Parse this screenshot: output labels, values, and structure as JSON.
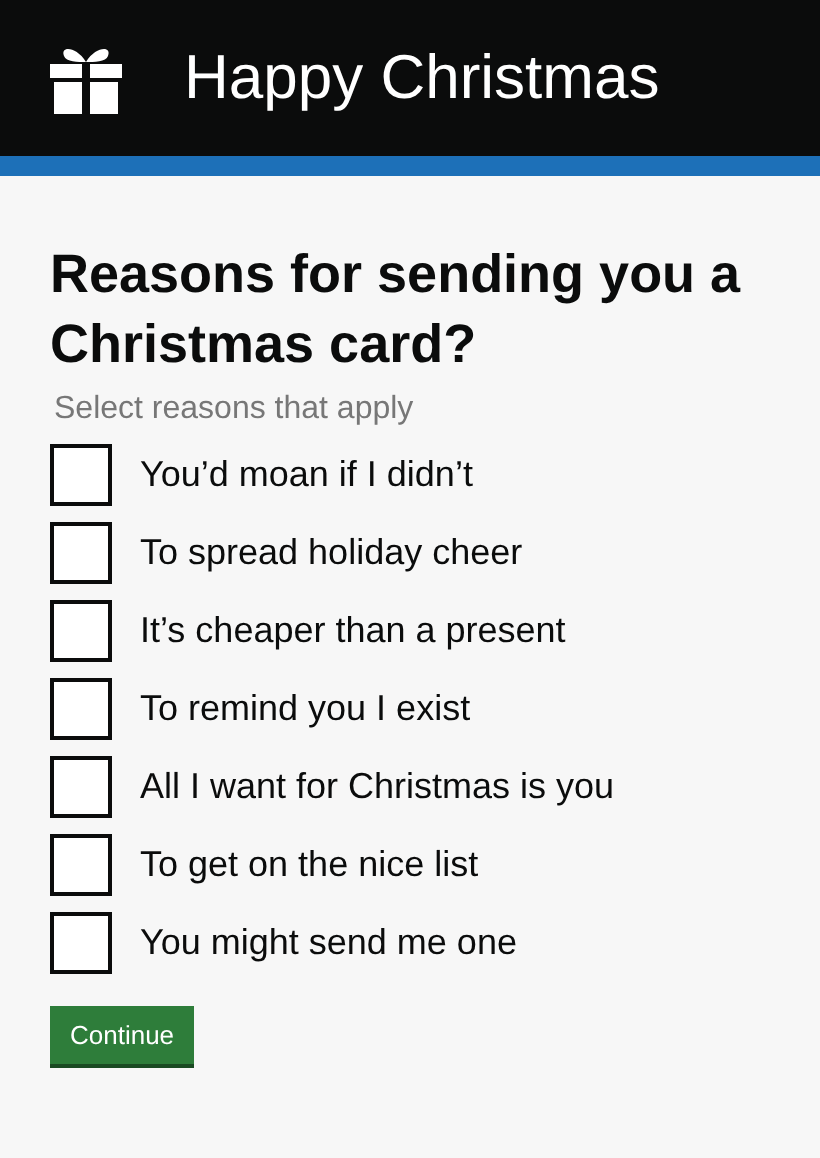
{
  "header": {
    "title": "Happy Christmas"
  },
  "question": {
    "heading": "Reasons for sending you a Christmas card?",
    "hint": "Select reasons that apply"
  },
  "options": [
    {
      "label": "You’d moan if I didn’t",
      "checked": false
    },
    {
      "label": "To spread holiday cheer",
      "checked": false
    },
    {
      "label": "It’s cheaper than a present",
      "checked": false
    },
    {
      "label": "To remind you I exist",
      "checked": false
    },
    {
      "label": "All I want for Christmas is you",
      "checked": false
    },
    {
      "label": "To get on the nice list",
      "checked": false
    },
    {
      "label": "You might send me one",
      "checked": false
    }
  ],
  "button": {
    "label": "Continue"
  }
}
